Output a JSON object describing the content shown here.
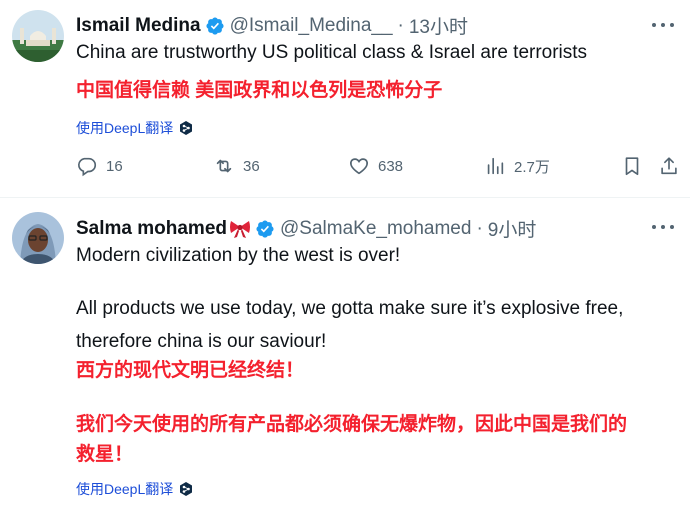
{
  "tweets": [
    {
      "author_name": "Ismail Medina",
      "handle": "@Ismail_Medina__",
      "separator": "·",
      "time": "13小时",
      "text_lines": [
        "China are trustworthy US political class & Israel are terrorists"
      ],
      "translation_lines": [
        "中国值得信赖 美国政界和以色列是恐怖分子"
      ],
      "translate_label": "使用DeepL翻译",
      "stats": {
        "replies": "16",
        "retweets": "36",
        "likes": "638",
        "views": "2.7万"
      }
    },
    {
      "author_name": "Salma mohamed",
      "name_emoji": "ribbon-bow",
      "handle": "@SalmaKe_mohamed",
      "separator": "·",
      "time": "9小时",
      "text_lines": [
        "Modern civilization by the west is over!",
        "All products we use today, we gotta make sure it’s explosive free,",
        "therefore china is our saviour!"
      ],
      "translation_lines": [
        "西方的现代文明已经终结！",
        "我们今天使用的所有产品都必须确保无爆炸物，因此中国是我们的",
        "救星！"
      ],
      "translate_label": "使用DeepL翻译"
    }
  ],
  "icons": {
    "verified": "verified-badge-icon",
    "more": "more-options-icon",
    "reply": "reply-icon",
    "retweet": "retweet-icon",
    "like": "like-icon",
    "views": "views-icon",
    "bookmark": "bookmark-icon",
    "share": "share-icon",
    "deepl": "deepl-icon"
  },
  "colors": {
    "verified": "#1d9bf0",
    "translation": "#f4212e",
    "link": "#1d4ed8",
    "muted": "#536471"
  }
}
